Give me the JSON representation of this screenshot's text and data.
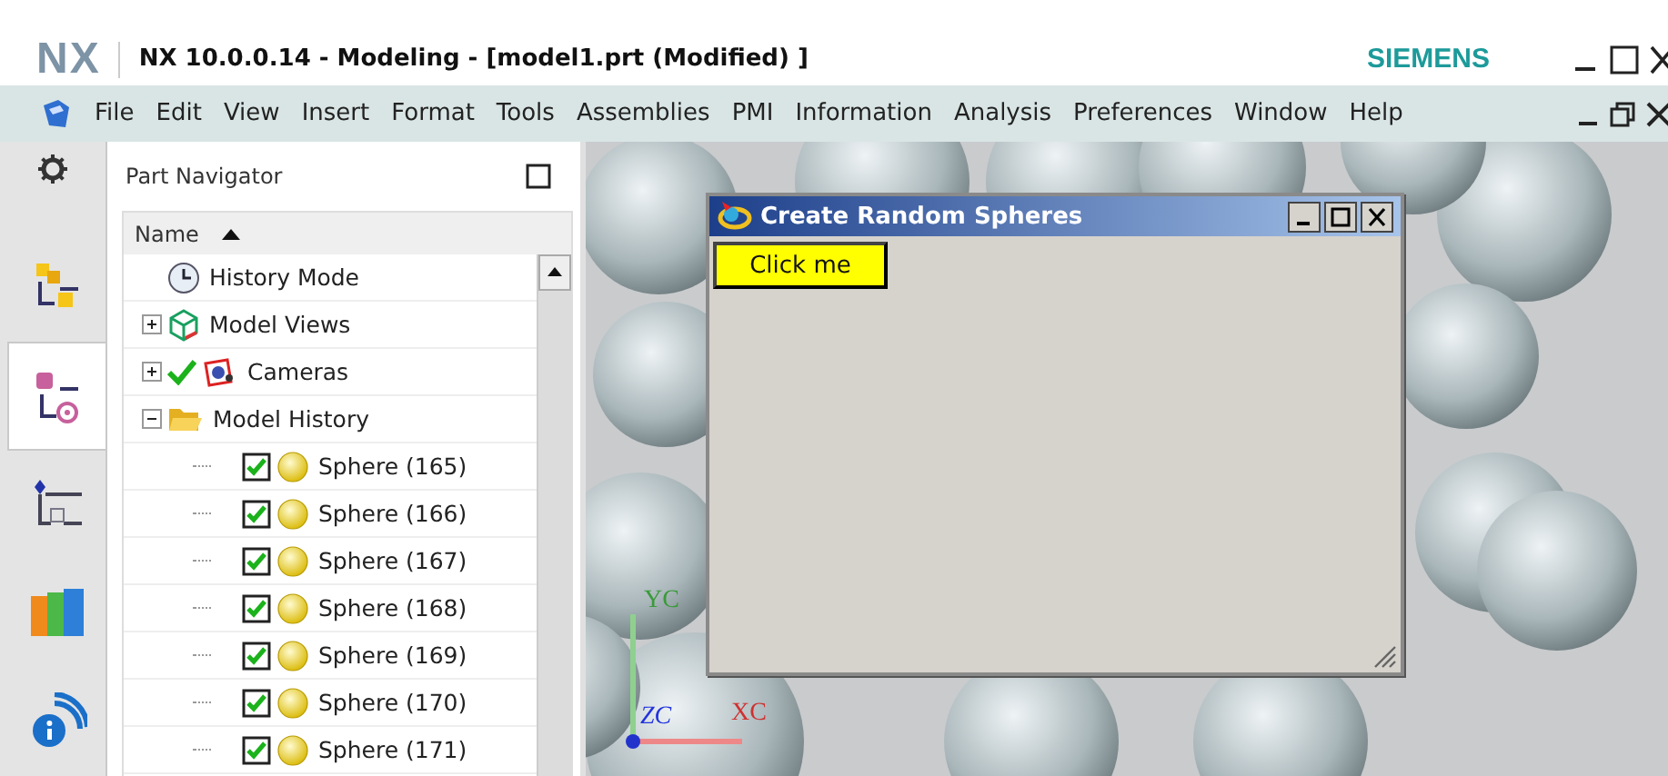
{
  "window": {
    "logo": "NX",
    "title": "NX 10.0.0.14 - Modeling - [model1.prt (Modified) ]",
    "brand": "SIEMENS"
  },
  "menu": [
    "File",
    "Edit",
    "View",
    "Insert",
    "Format",
    "Tools",
    "Assemblies",
    "PMI",
    "Information",
    "Analysis",
    "Preferences",
    "Window",
    "Help"
  ],
  "side_tabs": [
    {
      "kind": "assembly",
      "selected": false
    },
    {
      "kind": "part",
      "selected": true
    },
    {
      "kind": "constraint",
      "selected": false
    },
    {
      "kind": "library",
      "selected": false
    },
    {
      "kind": "info",
      "selected": false
    }
  ],
  "navigator": {
    "title": "Part Navigator",
    "column": "Name",
    "sort_ascending": true,
    "nodes": [
      {
        "kind": "clock",
        "label": "History Mode"
      },
      {
        "kind": "views",
        "label": "Model Views",
        "expanded": false
      },
      {
        "kind": "camera",
        "label": "Cameras",
        "expanded": false,
        "checked": true
      },
      {
        "kind": "folder",
        "label": "Model History",
        "expanded": true,
        "children": [
          {
            "kind": "sphere",
            "label": "Sphere (165)",
            "checked": true
          },
          {
            "kind": "sphere",
            "label": "Sphere (166)",
            "checked": true
          },
          {
            "kind": "sphere",
            "label": "Sphere (167)",
            "checked": true
          },
          {
            "kind": "sphere",
            "label": "Sphere (168)",
            "checked": true
          },
          {
            "kind": "sphere",
            "label": "Sphere (169)",
            "checked": true
          },
          {
            "kind": "sphere",
            "label": "Sphere (170)",
            "checked": true
          },
          {
            "kind": "sphere",
            "label": "Sphere (171)",
            "checked": true
          }
        ]
      }
    ]
  },
  "viewport": {
    "axes": {
      "y": "YC",
      "z": "ZC",
      "x": "XC"
    }
  },
  "dialog": {
    "title": "Create Random Spheres",
    "button": "Click me"
  }
}
